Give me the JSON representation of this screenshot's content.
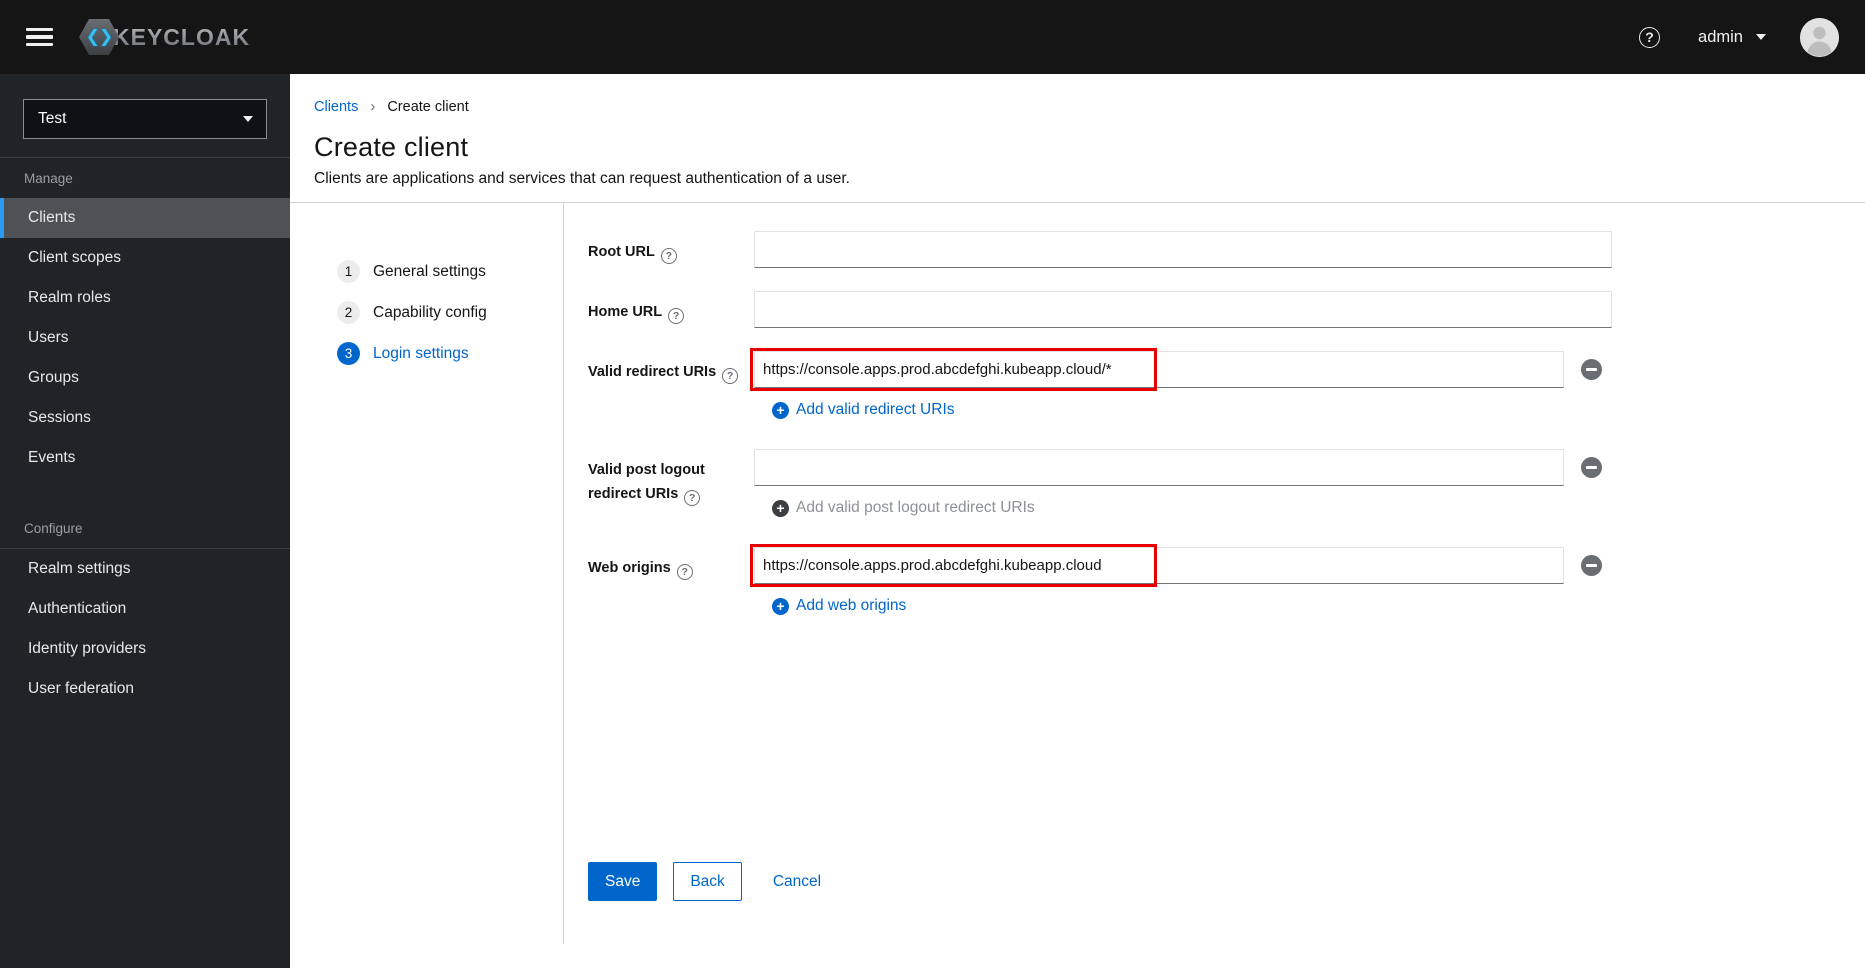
{
  "masthead": {
    "brand_text": "KEYCLOAK",
    "user_name": "admin"
  },
  "sidebar": {
    "realm": "Test",
    "manage_title": "Manage",
    "manage_items": [
      "Clients",
      "Client scopes",
      "Realm roles",
      "Users",
      "Groups",
      "Sessions",
      "Events"
    ],
    "active_item": "Clients",
    "configure_title": "Configure",
    "configure_items": [
      "Realm settings",
      "Authentication",
      "Identity providers",
      "User federation"
    ]
  },
  "breadcrumb": {
    "link": "Clients",
    "current": "Create client"
  },
  "page": {
    "title": "Create client",
    "subtitle": "Clients are applications and services that can request authentication of a user."
  },
  "wizard": {
    "steps": [
      {
        "number": "1",
        "label": "General settings"
      },
      {
        "number": "2",
        "label": "Capability config"
      },
      {
        "number": "3",
        "label": "Login settings"
      }
    ],
    "active_step": "Login settings"
  },
  "form": {
    "root_url": {
      "label": "Root URL",
      "value": ""
    },
    "home_url": {
      "label": "Home URL",
      "value": ""
    },
    "redirect_uris": {
      "label": "Valid redirect URIs",
      "value": "https://console.apps.prod.abcdefghi.kubeapp.cloud/*",
      "add_label": "Add valid redirect URIs"
    },
    "post_logout": {
      "label": "Valid post logout redirect URIs",
      "value": "",
      "add_label": "Add valid post logout redirect URIs"
    },
    "web_origins": {
      "label": "Web origins",
      "value": "https://console.apps.prod.abcdefghi.kubeapp.cloud",
      "add_label": "Add web origins"
    }
  },
  "actions": {
    "save": "Save",
    "back": "Back",
    "cancel": "Cancel"
  },
  "colors": {
    "primary": "#0066cc",
    "annotation": "#e60000",
    "masthead-bg": "#151515",
    "sidebar-bg": "#212427",
    "sidebar-accent": "#2b9af3"
  }
}
